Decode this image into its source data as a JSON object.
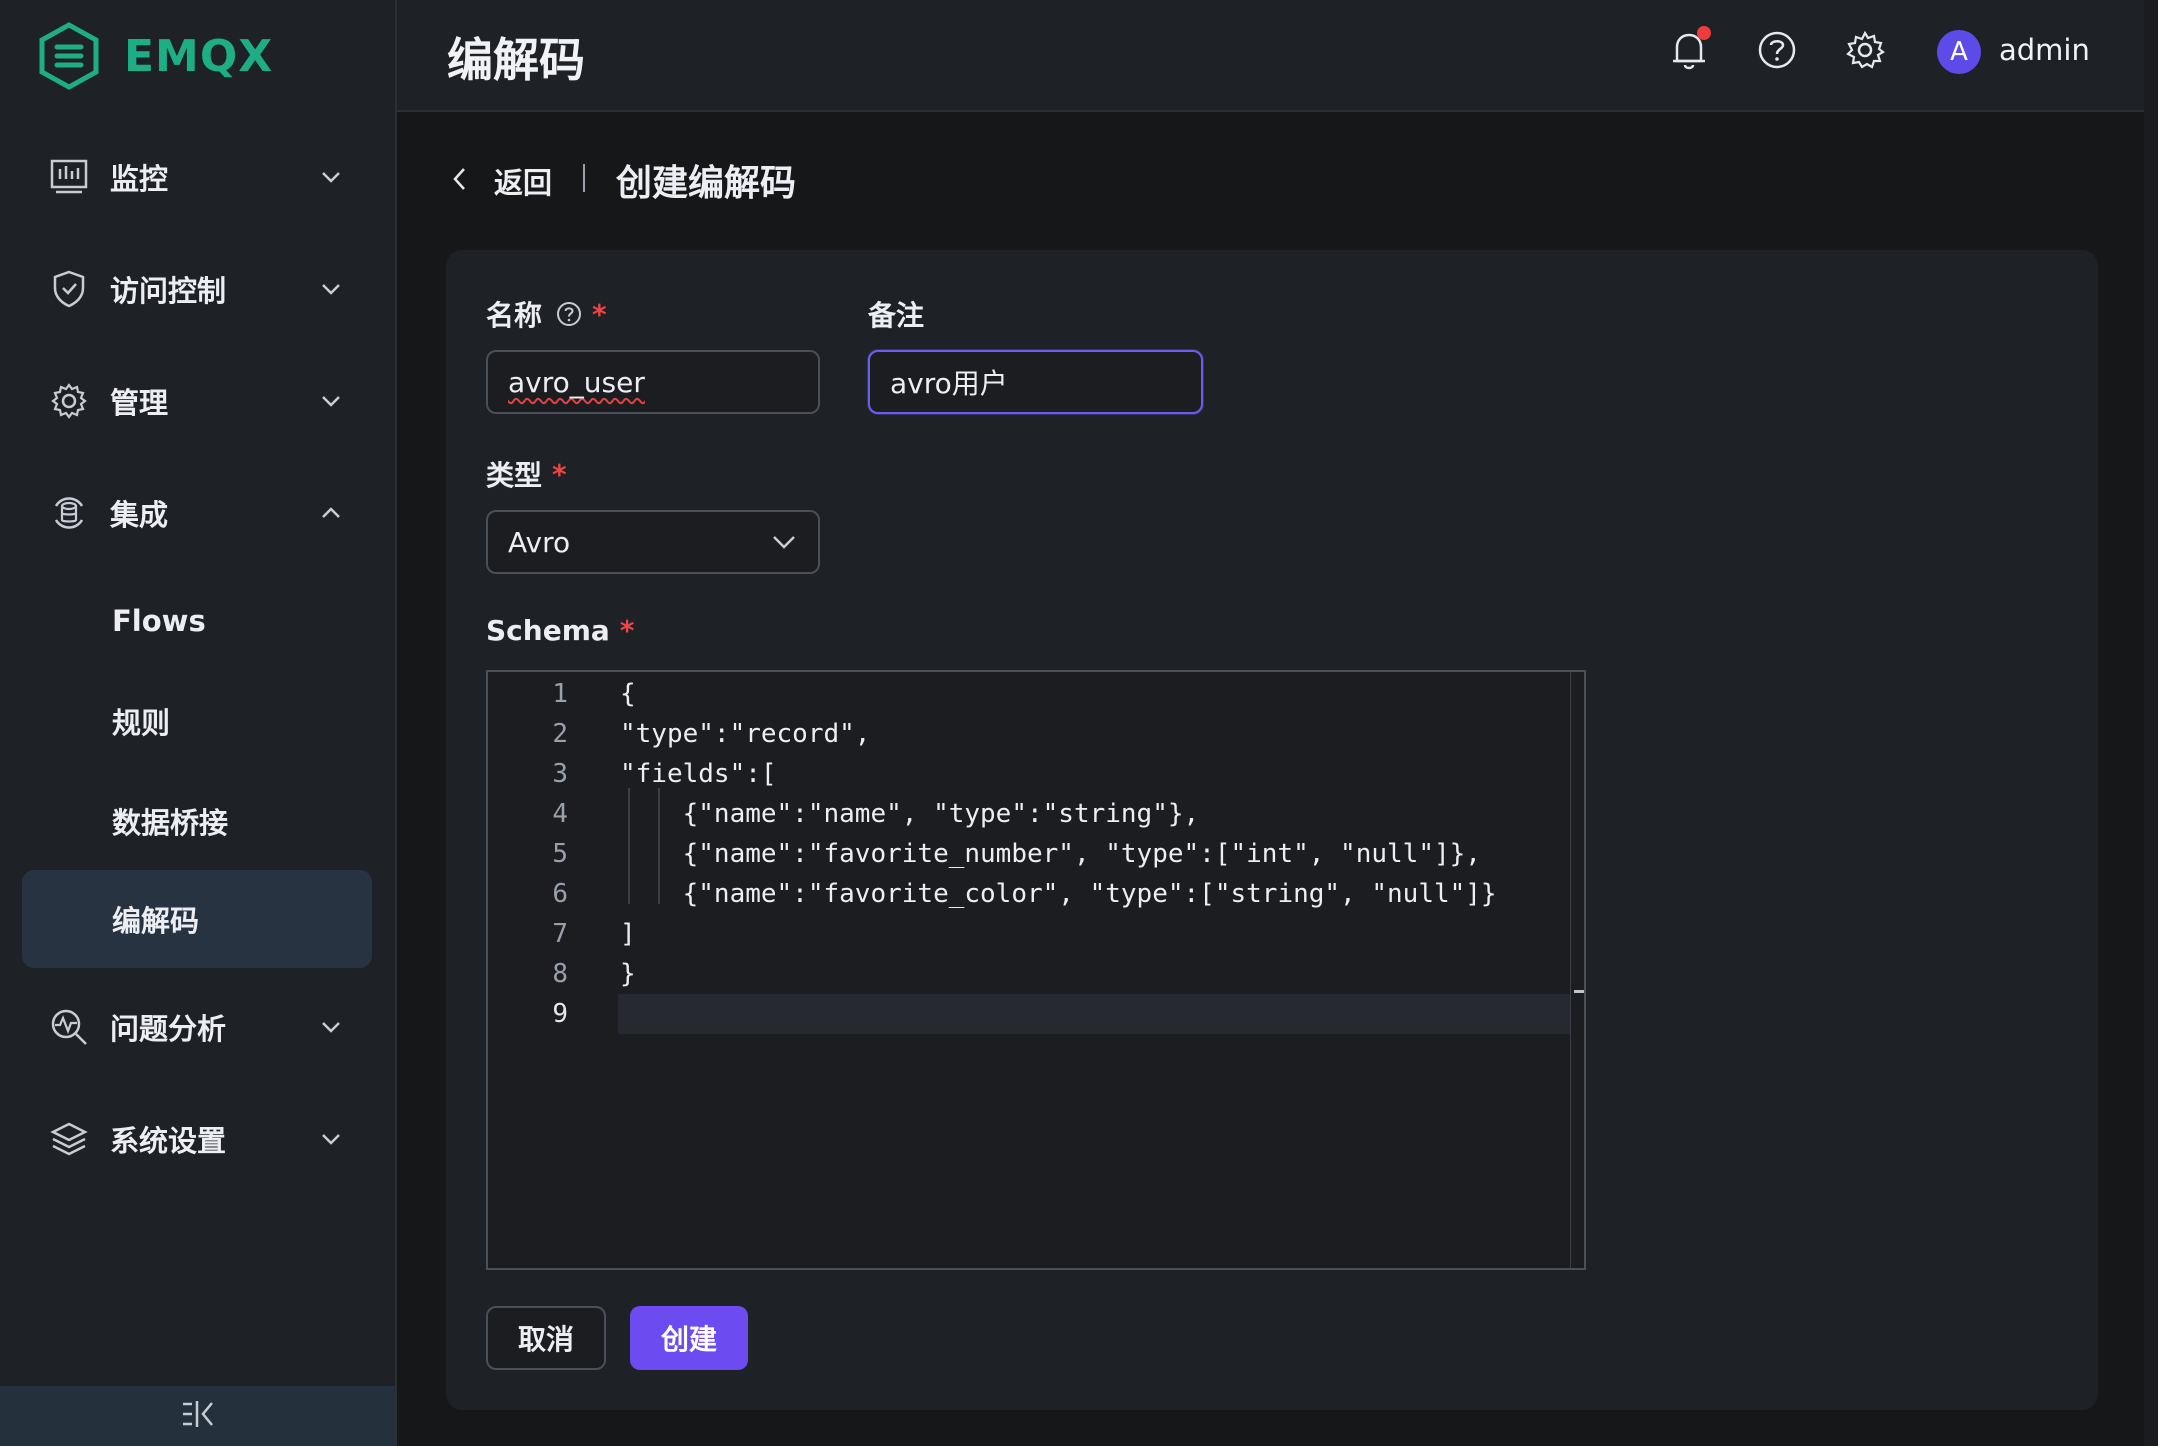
{
  "brand": {
    "name": "EMQX",
    "color": "#1dae86"
  },
  "header": {
    "title": "编解码",
    "username": "admin",
    "avatar_letter": "A",
    "icons": [
      "bell-icon",
      "help-icon",
      "settings-icon"
    ]
  },
  "sidebar": {
    "items": [
      {
        "label": "监控",
        "icon": "monitor-icon",
        "expanded": false
      },
      {
        "label": "访问控制",
        "icon": "shield-icon",
        "expanded": false
      },
      {
        "label": "管理",
        "icon": "gear-icon",
        "expanded": false
      },
      {
        "label": "集成",
        "icon": "integration-icon",
        "expanded": true
      },
      {
        "label": "问题分析",
        "icon": "diagnose-icon",
        "expanded": false
      },
      {
        "label": "系统设置",
        "icon": "layers-icon",
        "expanded": false
      }
    ],
    "sub_items": [
      {
        "label": "Flows",
        "active": false
      },
      {
        "label": "规则",
        "active": false
      },
      {
        "label": "数据桥接",
        "active": false
      },
      {
        "label": "编解码",
        "active": true
      }
    ]
  },
  "breadcrumb": {
    "back_label": "返回",
    "title": "创建编解码"
  },
  "form": {
    "name": {
      "label": "名称",
      "required": "*",
      "value": "avro_user"
    },
    "note": {
      "label": "备注",
      "value": "avro用户"
    },
    "type": {
      "label": "类型",
      "required": "*",
      "value": "Avro"
    },
    "schema": {
      "label": "Schema",
      "required": "*",
      "lines": [
        "{",
        "\"type\":\"record\",",
        "\"fields\":[",
        "    {\"name\":\"name\", \"type\":\"string\"},",
        "    {\"name\":\"favorite_number\", \"type\":[\"int\", \"null\"]},",
        "    {\"name\":\"favorite_color\", \"type\":[\"string\", \"null\"]}",
        "]",
        "}",
        ""
      ],
      "line_numbers": [
        "1",
        "2",
        "3",
        "4",
        "5",
        "6",
        "7",
        "8",
        "9"
      ]
    }
  },
  "buttons": {
    "cancel": "取消",
    "create": "创建"
  },
  "colors": {
    "accent": "#6c4bf0",
    "required": "#ef4444",
    "notification": "#ee3b3b"
  }
}
